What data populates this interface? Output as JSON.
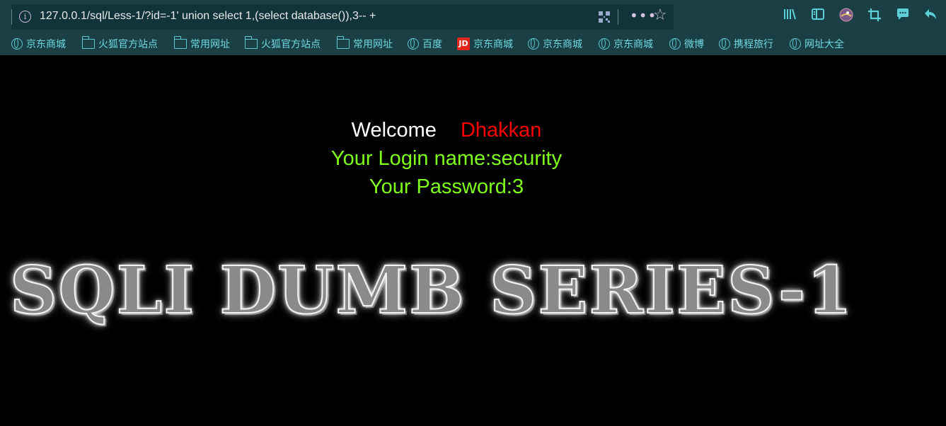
{
  "browser": {
    "url": "127.0.0.1/sql/Less-1/?id=-1' union select 1,(select database()),3-- +",
    "info_icon": "i",
    "more_icon": "•••",
    "star_icon": "☆",
    "toolbar_icons": [
      "library-icon",
      "sidebar-icon",
      "profile-icon",
      "screenshot-crop-icon",
      "chat-icon",
      "undo-icon"
    ],
    "accent_color": "#4fd2d8"
  },
  "bookmarks": [
    {
      "icon": "globe",
      "label": "京东商城"
    },
    {
      "icon": "folder",
      "label": "火狐官方站点"
    },
    {
      "icon": "folder",
      "label": "常用网址"
    },
    {
      "icon": "folder",
      "label": "火狐官方站点"
    },
    {
      "icon": "folder",
      "label": "常用网址"
    },
    {
      "icon": "globe",
      "label": "百度"
    },
    {
      "icon": "jd",
      "label": "京东商城",
      "badge": "JD"
    },
    {
      "icon": "globe",
      "label": "京东商城"
    },
    {
      "icon": "globe",
      "label": "京东商城"
    },
    {
      "icon": "globe",
      "label": "微博"
    },
    {
      "icon": "globe",
      "label": "携程旅行"
    },
    {
      "icon": "globe",
      "label": "网址大全"
    }
  ],
  "page": {
    "welcome": "Welcome",
    "name": "Dhakkan",
    "login": "Your Login name:security",
    "password": "Your Password:3",
    "banner": "SQLI DUMB SERIES-1",
    "colors": {
      "background": "#000000",
      "welcome": "#ffffff",
      "name": "#ff0000",
      "result": "#7fff1a"
    }
  }
}
